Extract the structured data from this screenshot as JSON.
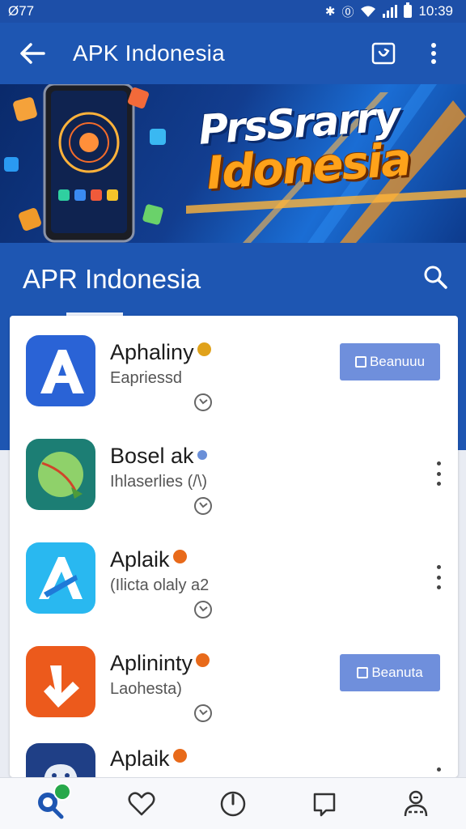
{
  "status_bar": {
    "left_text": "Ø77",
    "time": "10:39"
  },
  "app_bar": {
    "title": "APK Indonesia"
  },
  "banner": {
    "line1": "PrsSrarry",
    "line2": "Idonesia"
  },
  "section": {
    "title": "APR Indonesia"
  },
  "apps": [
    {
      "name": "Aphaliny",
      "subtitle": "Eapriessd",
      "button_label": "Beanuuu",
      "badge_color": "#e0a21b",
      "icon": "blue-a-icon"
    },
    {
      "name": "Bosel ak",
      "subtitle": "Ihlaserlies (/\\)",
      "badge_color": "#6a8fd8",
      "icon": "green-ball-icon"
    },
    {
      "name": "Aplaik",
      "subtitle": "(Ilicta olaly a2",
      "badge_color": "#e86a1a",
      "icon": "cyan-a-icon"
    },
    {
      "name": "Aplininty",
      "subtitle": "Laohesta)",
      "button_label": "Beanuta",
      "badge_color": "#e86a1a",
      "icon": "orange-arrow-icon"
    },
    {
      "name": "Aplaik",
      "subtitle": "",
      "badge_color": "#e86a1a",
      "icon": "android-icon"
    }
  ],
  "colors": {
    "primary": "#1e56b2",
    "button": "#6f8fdc",
    "notification_dot": "#27a84a"
  }
}
